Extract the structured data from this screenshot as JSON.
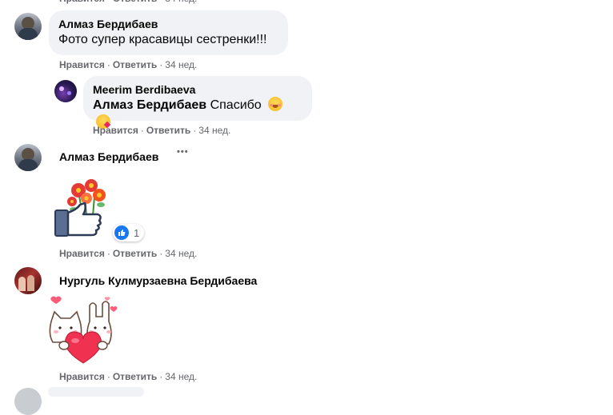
{
  "comments": [
    {
      "author": "Алмаз Бердибаев",
      "text": "Фото супер красавицы сестренки!!!",
      "like": "Нравится",
      "reply": "Ответить",
      "time": "34 нед.",
      "top_cut_actions": "Нравится · Ответить · 34 нед."
    },
    {
      "author": "Meerim Berdibaeva",
      "mention": "Алмаз Бердибаев",
      "text": "Спасибо",
      "like": "Нравится",
      "reply": "Ответить",
      "time": "34 нед."
    },
    {
      "author": "Алмаз Бердибаев",
      "sticker": "thumbs-up-with-flowers-sticker",
      "more": "•••",
      "reaction_count": "1",
      "like": "Нравится",
      "reply": "Ответить",
      "time": "34 нед."
    },
    {
      "author": "Нургуль Кулмурзаевна Бердибаева",
      "sticker": "cute-cats-with-heart-sticker",
      "like": "Нравится",
      "reply": "Ответить",
      "time": "34 нед."
    }
  ],
  "separator": "·",
  "colors": {
    "bubble": "#f0f2f5",
    "meta": "#65676b",
    "like_blue": "#1877f2"
  }
}
